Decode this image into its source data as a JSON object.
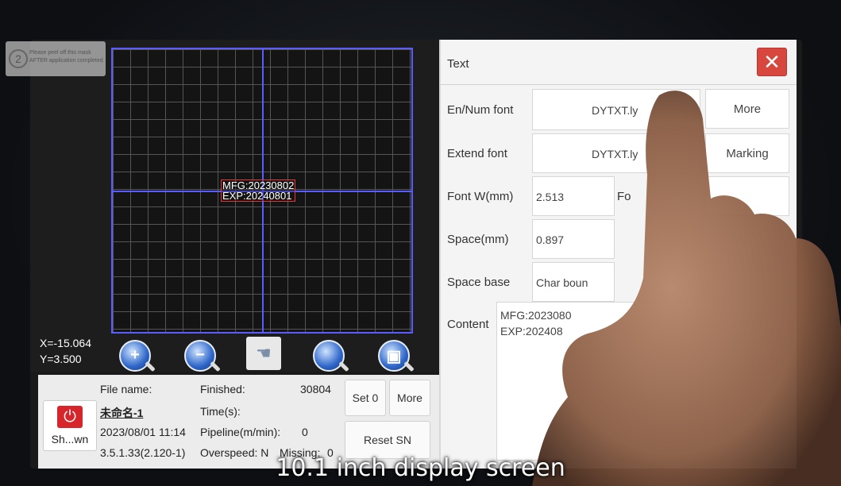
{
  "sticker": {
    "number": "2",
    "line1": "Please peel off this mask",
    "line2": "AFTER application completed"
  },
  "canvas": {
    "mark_lines": [
      "MFG:20230802",
      "EXP:20240801"
    ],
    "coord_x": "X=-15.064",
    "coord_y": "Y=3.500",
    "tools": [
      "zoom-in-icon",
      "zoom-out-icon",
      "hand-pan-icon",
      "zoom-fit-icon",
      "zoom-reset-icon"
    ]
  },
  "status": {
    "power_label": "Sh...wn",
    "file_name_label": "File name:",
    "file_name_value": "未命名-1",
    "datetime": "2023/08/01 11:14",
    "version": "3.5.1.33(2.120-1)",
    "finished_label": "Finished:",
    "finished_value": "30804",
    "time_label": "Time(s):",
    "pipeline_label": "Pipeline(m/min):",
    "pipeline_value": "0",
    "overspeed_label": "Overspeed: N",
    "missing_label": "Missing:",
    "missing_value": "0",
    "set0_label": "Set 0",
    "more_label": "More",
    "reset_sn_label": "Reset SN"
  },
  "dialog": {
    "title": "Text",
    "close_label": "✕",
    "en_num_font_label": "En/Num font",
    "en_num_font_value": "DYTXT.ly",
    "more_label": "More",
    "extend_font_label": "Extend font",
    "extend_font_value": "DYTXT.ly",
    "marking_label": "Marking",
    "font_w_label": "Font W(mm)",
    "font_w_value": "2.513",
    "font_h_partial": "Fo",
    "space_label": "Space(mm)",
    "space_value": "0.897",
    "space_base_label": "Space base",
    "space_base_value": "Char boun",
    "content_label": "Content",
    "content_lines": [
      "MFG:2023080",
      "EXP:202408"
    ]
  },
  "caption": "10.1 inch display screen",
  "colors": {
    "grid_axis": "#5a5cff",
    "power": "#d6262b",
    "close": "#d8473d"
  }
}
